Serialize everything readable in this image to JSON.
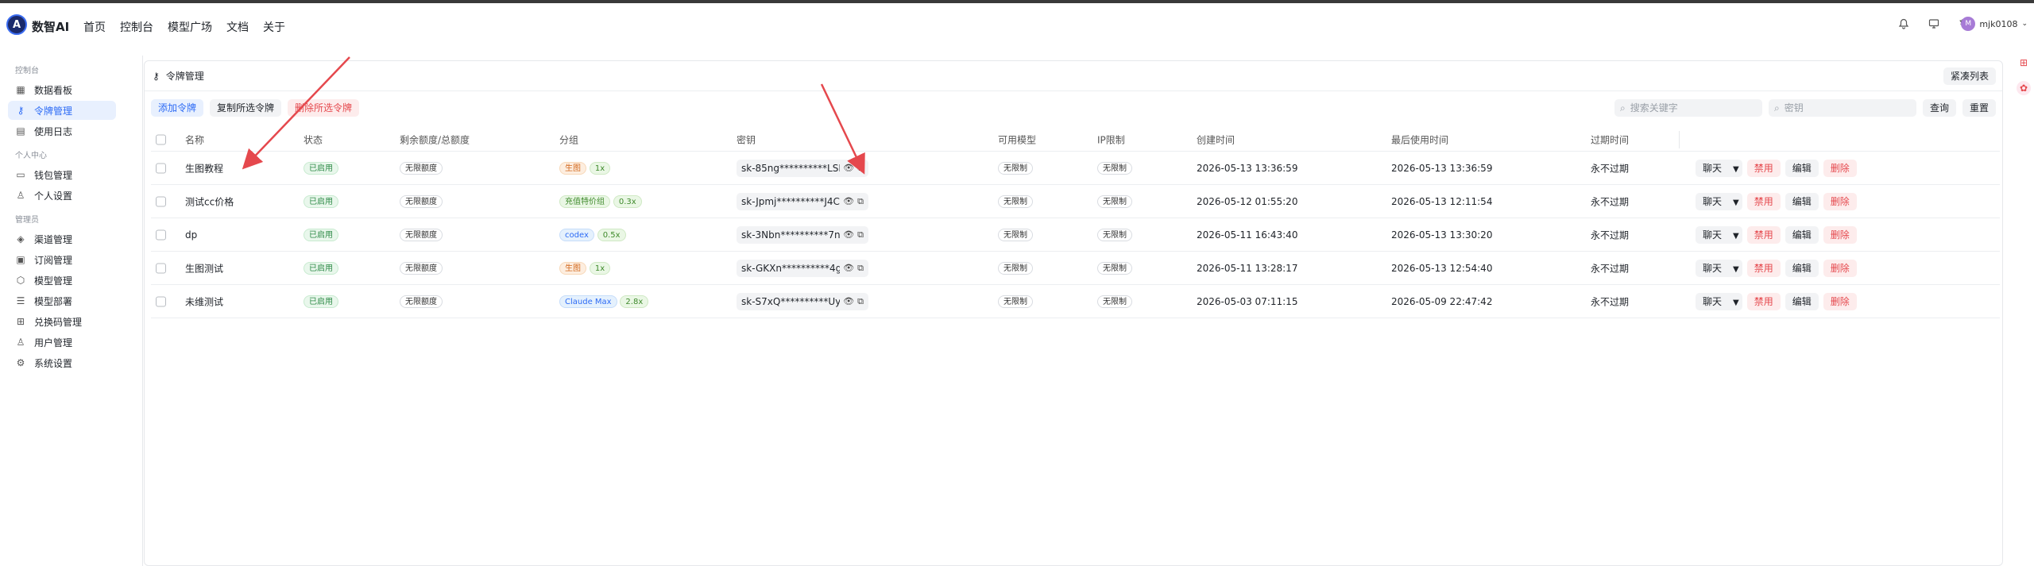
{
  "header": {
    "brand": "数智AI",
    "logo_letter": "A",
    "nav": [
      "首页",
      "控制台",
      "模型广场",
      "文档",
      "关于"
    ],
    "user_avatar": "M",
    "user_name": "mjk0108"
  },
  "sidebar": {
    "groups": [
      {
        "title": "控制台",
        "items": [
          "数据看板",
          "令牌管理",
          "使用日志"
        ]
      },
      {
        "title": "个人中心",
        "items": [
          "钱包管理",
          "个人设置"
        ]
      },
      {
        "title": "管理员",
        "items": [
          "渠道管理",
          "订阅管理",
          "模型管理",
          "模型部署",
          "兑换码管理",
          "用户管理",
          "系统设置"
        ]
      }
    ],
    "active": "令牌管理"
  },
  "page": {
    "title": "令牌管理",
    "compact_label": "紧凑列表",
    "add_label": "添加令牌",
    "copy_selected_label": "复制所选令牌",
    "delete_selected_label": "删除所选令牌",
    "search_keyword_placeholder": "搜索关键字",
    "search_key_placeholder": "密钥",
    "query_label": "查询",
    "reset_label": "重置"
  },
  "table": {
    "columns": [
      "名称",
      "状态",
      "剩余额度/总额度",
      "分组",
      "密钥",
      "可用模型",
      "IP限制",
      "创建时间",
      "最后使用时间",
      "过期时间"
    ],
    "rows": [
      {
        "name": "生图教程",
        "status": "已启用",
        "quota": "无限额度",
        "group": "生图",
        "group_color": "orange",
        "ratio": "1x",
        "key": "sk-85ng**********LSI",
        "models": "无限制",
        "ip": "无限制",
        "created": "2026-05-13 13:36:59",
        "last_used": "2026-05-13 13:36:59",
        "expire": "永不过期"
      },
      {
        "name": "测试cc价格",
        "status": "已启用",
        "quota": "无限额度",
        "group": "充值特价组",
        "group_color": "lightgreen",
        "ratio": "0.3x",
        "key": "sk-Jpmj**********J4C",
        "models": "无限制",
        "ip": "无限制",
        "created": "2026-05-12 01:55:20",
        "last_used": "2026-05-13 12:11:54",
        "expire": "永不过期"
      },
      {
        "name": "dp",
        "status": "已启用",
        "quota": "无限额度",
        "group": "codex",
        "group_color": "blue",
        "ratio": "0.5x",
        "key": "sk-3Nbn**********7nl",
        "models": "无限制",
        "ip": "无限制",
        "created": "2026-05-11 16:43:40",
        "last_used": "2026-05-13 13:30:20",
        "expire": "永不过期"
      },
      {
        "name": "生图测试",
        "status": "已启用",
        "quota": "无限额度",
        "group": "生图",
        "group_color": "orange",
        "ratio": "1x",
        "key": "sk-GKXn**********4g",
        "models": "无限制",
        "ip": "无限制",
        "created": "2026-05-11 13:28:17",
        "last_used": "2026-05-13 12:54:40",
        "expire": "永不过期"
      },
      {
        "name": "未维测试",
        "status": "已启用",
        "quota": "无限额度",
        "group": "Claude Max",
        "group_color": "blue",
        "ratio": "2.8x",
        "key": "sk-S7xQ**********Uy",
        "models": "无限制",
        "ip": "无限制",
        "created": "2026-05-03 07:11:15",
        "last_used": "2026-05-09 22:47:42",
        "expire": "永不过期"
      }
    ],
    "actions": {
      "chat": "聊天",
      "disable": "禁用",
      "edit": "编辑",
      "delete": "删除"
    }
  },
  "colors": {
    "accent": "#2d6bf5",
    "danger": "#e5484d",
    "arrow": "#e5484d"
  }
}
